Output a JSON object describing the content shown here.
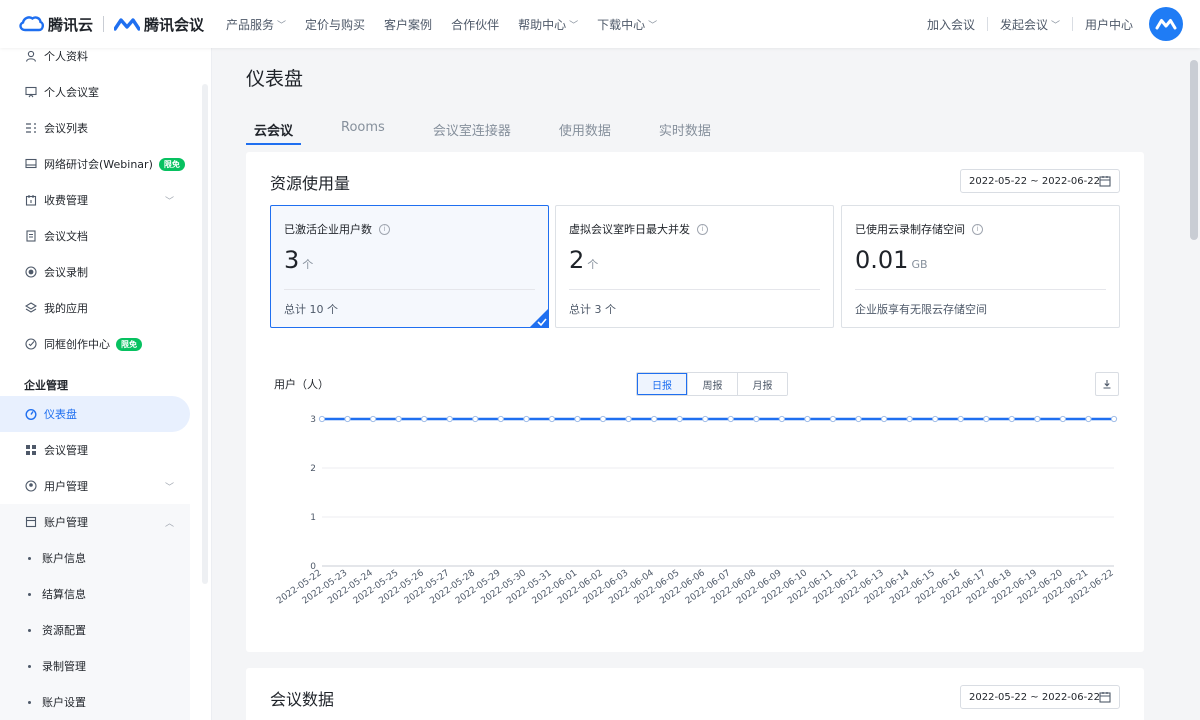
{
  "brand": {
    "cloud_name": "腾讯云",
    "meeting_name": "腾讯会议"
  },
  "topnav": {
    "links": [
      "产品服务",
      "定价与购买",
      "客户案例",
      "合作伙伴",
      "帮助中心",
      "下载中心"
    ],
    "right": {
      "join": "加入会议",
      "start": "发起会议",
      "user_center": "用户中心"
    }
  },
  "sidebar": {
    "items": [
      {
        "label": "个人资料",
        "icon": "person-icon"
      },
      {
        "label": "个人会议室",
        "icon": "meeting-room-icon"
      },
      {
        "label": "会议列表",
        "icon": "list-icon"
      },
      {
        "label": "网络研讨会(Webinar)",
        "icon": "monitor-icon",
        "tag": "限免"
      },
      {
        "label": "收费管理",
        "icon": "fee-icon"
      },
      {
        "label": "会议文档",
        "icon": "document-icon"
      },
      {
        "label": "会议录制",
        "icon": "record-icon"
      },
      {
        "label": "我的应用",
        "icon": "layers-icon"
      },
      {
        "label": "同框创作中心",
        "icon": "creation-icon",
        "tag": "限免"
      }
    ],
    "section_title": "企业管理",
    "enterprise_items": [
      {
        "label": "仪表盘",
        "icon": "dashboard-icon"
      },
      {
        "label": "会议管理",
        "icon": "grid-icon"
      },
      {
        "label": "用户管理",
        "icon": "users-icon"
      },
      {
        "label": "账户管理",
        "icon": "account-icon"
      }
    ],
    "account_sub": [
      "账户信息",
      "结算信息",
      "资源配置",
      "录制管理",
      "账户设置"
    ]
  },
  "page": {
    "title": "仪表盘",
    "tabs": [
      "云会议",
      "Rooms",
      "会议室连接器",
      "使用数据",
      "实时数据"
    ]
  },
  "resource": {
    "title": "资源使用量",
    "date_range": "2022-05-22 ~ 2022-06-22",
    "stats": [
      {
        "label": "已激活企业用户数",
        "value": "3",
        "unit": "个",
        "footer": "总计 10 个"
      },
      {
        "label": "虚拟会议室昨日最大并发",
        "value": "2",
        "unit": "个",
        "footer": "总计 3 个"
      },
      {
        "label": "已使用云录制存储空间",
        "value": "0.01",
        "unit": "GB",
        "footer": "企业版享有无限云存储空间"
      }
    ],
    "chart_ylabel": "用户（人）",
    "periods": [
      "日报",
      "周报",
      "月报"
    ]
  },
  "meeting_data": {
    "title": "会议数据",
    "date_range": "2022-05-22 ~ 2022-06-22"
  },
  "chart_data": {
    "type": "line",
    "ylim": [
      0,
      3
    ],
    "yticks": [
      0,
      1,
      2,
      3
    ],
    "grid": true,
    "x": [
      "2022-05-22",
      "2022-05-23",
      "2022-05-24",
      "2022-05-25",
      "2022-05-26",
      "2022-05-27",
      "2022-05-28",
      "2022-05-29",
      "2022-05-30",
      "2022-05-31",
      "2022-06-01",
      "2022-06-02",
      "2022-06-03",
      "2022-06-04",
      "2022-06-05",
      "2022-06-06",
      "2022-06-07",
      "2022-06-08",
      "2022-06-09",
      "2022-06-10",
      "2022-06-11",
      "2022-06-12",
      "2022-06-13",
      "2022-06-14",
      "2022-06-15",
      "2022-06-16",
      "2022-06-17",
      "2022-06-18",
      "2022-06-19",
      "2022-06-20",
      "2022-06-21",
      "2022-06-22"
    ],
    "series": [
      {
        "values": [
          3,
          3,
          3,
          3,
          3,
          3,
          3,
          3,
          3,
          3,
          3,
          3,
          3,
          3,
          3,
          3,
          3,
          3,
          3,
          3,
          3,
          3,
          3,
          3,
          3,
          3,
          3,
          3,
          3,
          3,
          3,
          3
        ],
        "color": "#1f6ff0"
      }
    ]
  }
}
